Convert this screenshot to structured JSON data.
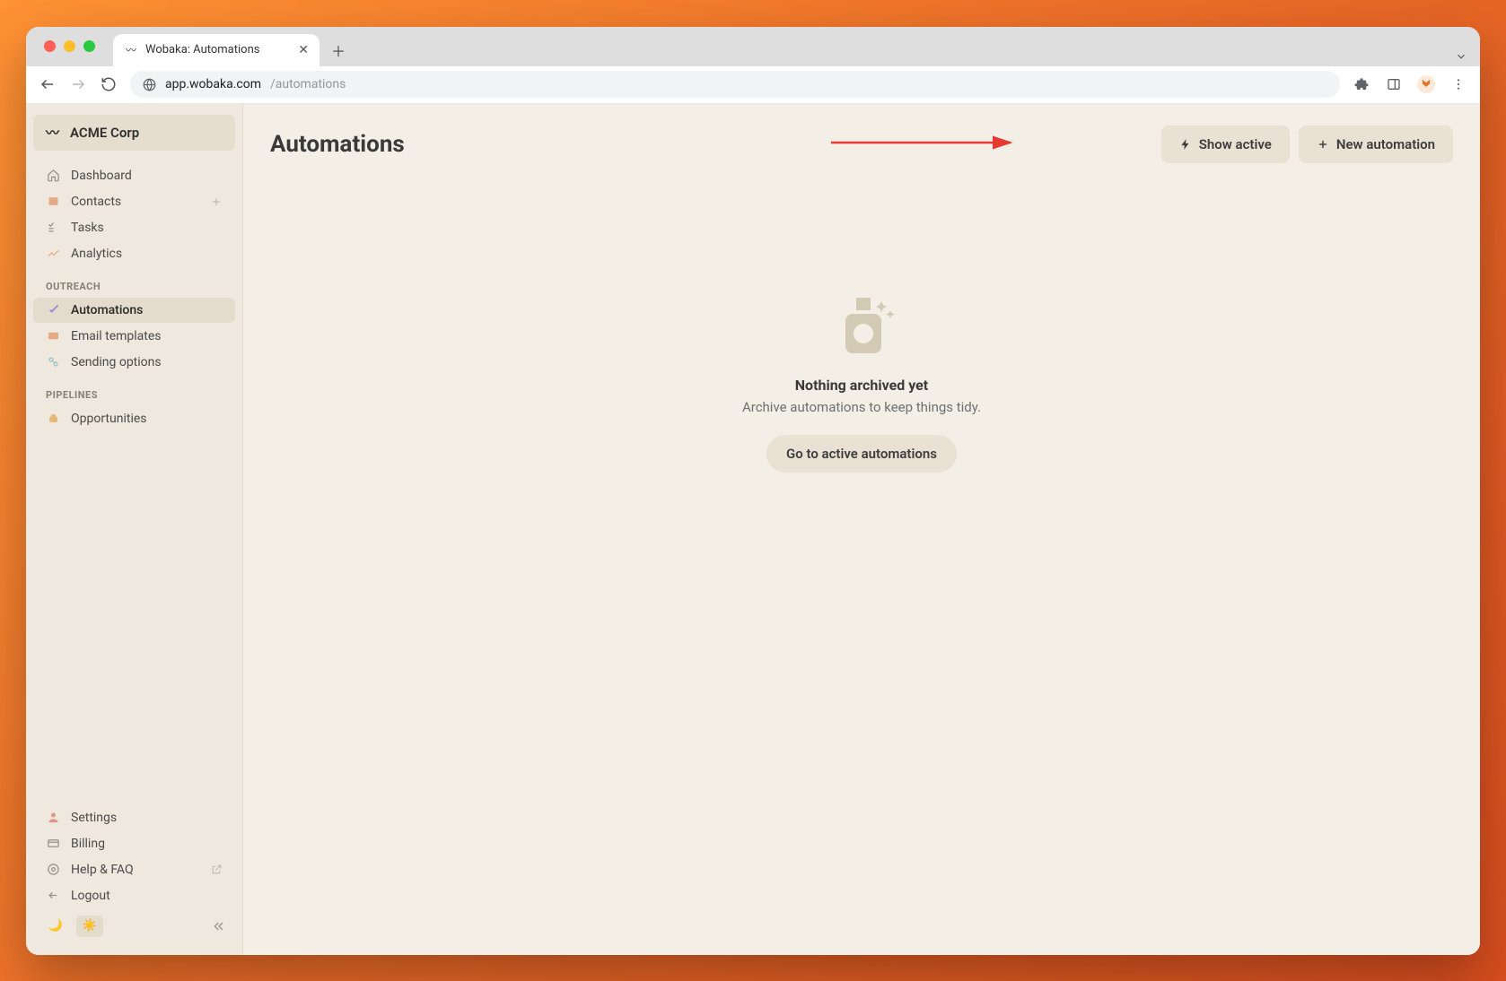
{
  "browser": {
    "tab_title": "Wobaka: Automations",
    "url_host": "app.wobaka.com",
    "url_path": "/automations"
  },
  "sidebar": {
    "company": "ACME Corp",
    "main_items": [
      {
        "label": "Dashboard"
      },
      {
        "label": "Contacts"
      },
      {
        "label": "Tasks"
      },
      {
        "label": "Analytics"
      }
    ],
    "section_outreach": "OUTREACH",
    "outreach_items": [
      {
        "label": "Automations"
      },
      {
        "label": "Email templates"
      },
      {
        "label": "Sending options"
      }
    ],
    "section_pipelines": "PIPELINES",
    "pipeline_items": [
      {
        "label": "Opportunities"
      }
    ],
    "footer_items": [
      {
        "label": "Settings"
      },
      {
        "label": "Billing"
      },
      {
        "label": "Help & FAQ"
      },
      {
        "label": "Logout"
      }
    ]
  },
  "header": {
    "title": "Automations",
    "show_active": "Show active",
    "new_automation": "New automation"
  },
  "empty": {
    "title": "Nothing archived yet",
    "subtitle": "Archive automations to keep things tidy.",
    "cta": "Go to active automations"
  }
}
